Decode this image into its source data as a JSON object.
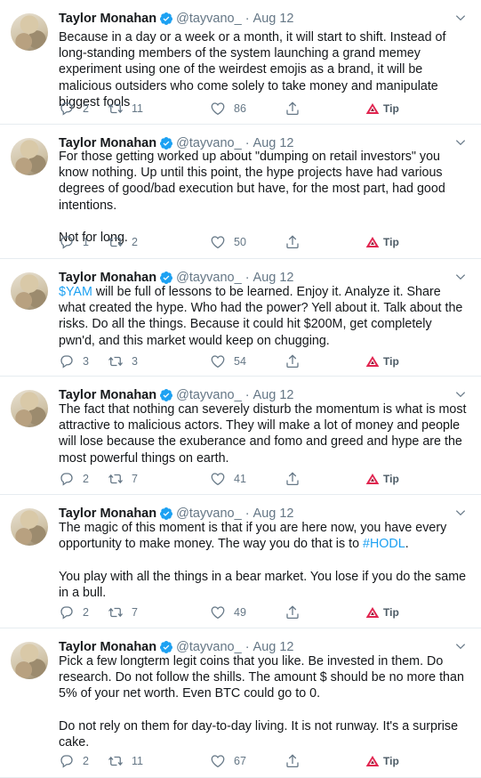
{
  "tweets": [
    {
      "author": "Taylor Monahan",
      "handle": "@tayvano_",
      "date": "Aug 12",
      "paragraphs": [
        [
          {
            "t": "Because in a day or a week or a month, it will start to shift. Instead of long-standing members of the system launching a grand memey experiment using one of the weirdest  emojis as a brand, it will be malicious outsiders who come solely to take money and manipulate biggest fools"
          }
        ]
      ],
      "replies": "2",
      "retweets": "11",
      "likes": "86",
      "tip": "Tip"
    },
    {
      "author": "Taylor Monahan",
      "handle": "@tayvano_",
      "date": "Aug 12",
      "paragraphs": [
        [
          {
            "t": "For those getting worked up about \"dumping on retail investors\" you know nothing. Up until this point, the hype projects have had various degrees of good/bad execution but have, for the most part, had good intentions."
          }
        ],
        [
          {
            "t": "Not for long."
          }
        ]
      ],
      "replies": "1",
      "retweets": "2",
      "likes": "50",
      "tip": "Tip"
    },
    {
      "author": "Taylor Monahan",
      "handle": "@tayvano_",
      "date": "Aug 12",
      "paragraphs": [
        [
          {
            "t": "$YAM",
            "link": true
          },
          {
            "t": " will be full of lessons to be learned. Enjoy it. Analyze it. Share what created the hype. Who had the power? Yell about it. Talk about the risks. Do all the things. Because it could hit $200M, get completely pwn'd, and this market would keep on chugging."
          }
        ]
      ],
      "replies": "3",
      "retweets": "3",
      "likes": "54",
      "tip": "Tip"
    },
    {
      "author": "Taylor Monahan",
      "handle": "@tayvano_",
      "date": "Aug 12",
      "paragraphs": [
        [
          {
            "t": "The fact that nothing can severely disturb the momentum is what is most attractive to malicious actors. They will make a lot of money and people will lose because the exuberance and fomo and greed and hype are the most powerful things on earth."
          }
        ]
      ],
      "replies": "2",
      "retweets": "7",
      "likes": "41",
      "tip": "Tip"
    },
    {
      "author": "Taylor Monahan",
      "handle": "@tayvano_",
      "date": "Aug 12",
      "paragraphs": [
        [
          {
            "t": "The magic of this moment is that if you are here now, you have every opportunity to make money. The way you do that is to "
          },
          {
            "t": "#HODL",
            "link": true
          },
          {
            "t": "."
          }
        ],
        [
          {
            "t": "You play with all the things in a bear market. You lose if you do the same in a bull."
          }
        ]
      ],
      "replies": "2",
      "retweets": "7",
      "likes": "49",
      "tip": "Tip"
    },
    {
      "author": "Taylor Monahan",
      "handle": "@tayvano_",
      "date": "Aug 12",
      "paragraphs": [
        [
          {
            "t": "Pick a few longterm legit coins that you like. Be invested in them. Do research. Do not follow the shills. The amount $ should be no more than 5% of your net worth. Even BTC could go to 0."
          }
        ],
        [
          {
            "t": "Do not rely on them for day-to-day living. It is not runway. It's a surprise cake."
          }
        ]
      ],
      "replies": "2",
      "retweets": "11",
      "likes": "67",
      "tip": "Tip"
    }
  ],
  "colors": {
    "text": "#14171a",
    "muted": "#657786",
    "link": "#1da1f2",
    "verified": "#1da1f2",
    "tip_brand": "#e0234e",
    "divider": "#e6ecf0"
  },
  "icons": {
    "verified": "verified-badge-icon",
    "caret": "chevron-down-icon",
    "reply": "reply-icon",
    "retweet": "retweet-icon",
    "like": "heart-icon",
    "share": "share-icon",
    "tip": "tip-triangle-icon"
  }
}
